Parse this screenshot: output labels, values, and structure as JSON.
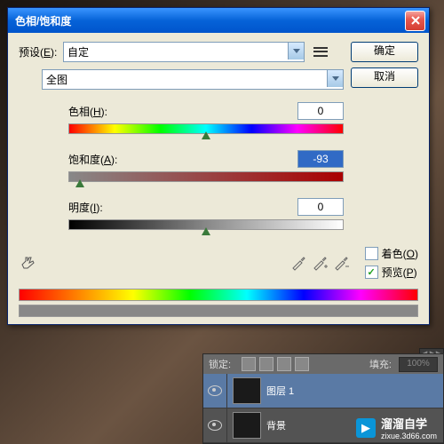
{
  "dialog": {
    "title": "色相/饱和度",
    "preset_label": "预设(",
    "preset_key": "E",
    "preset_suffix": "):",
    "preset_value": "自定",
    "channel_value": "全图",
    "ok": "确定",
    "cancel": "取消",
    "hue": {
      "label": "色相(",
      "key": "H",
      "suffix": "):",
      "value": "0",
      "pos": 50
    },
    "sat": {
      "label": "饱和度(",
      "key": "A",
      "suffix": "):",
      "value": "-93",
      "pos": 4
    },
    "light": {
      "label": "明度(",
      "key": "I",
      "suffix": "):",
      "value": "0",
      "pos": 50
    },
    "colorize": {
      "label": "着色(",
      "key": "O",
      "suffix": ")",
      "checked": false
    },
    "preview": {
      "label": "预览(",
      "key": "P",
      "suffix": ")",
      "checked": true
    }
  },
  "layers": {
    "lock_label": "锁定:",
    "fill_label": "填充:",
    "fill_value": "100%",
    "items": [
      {
        "name": "图层 1",
        "active": true
      },
      {
        "name": "背景",
        "active": false
      }
    ]
  },
  "watermark": {
    "text": "溜溜自学",
    "url": "zixue.3d66.com"
  }
}
